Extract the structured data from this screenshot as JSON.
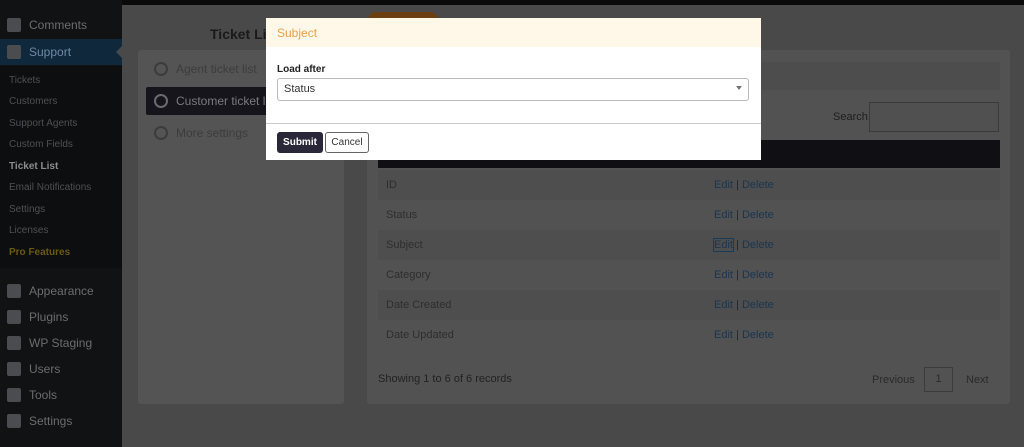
{
  "sidebar": {
    "items": [
      {
        "label": "Comments",
        "icon": "comment-icon"
      },
      {
        "label": "Support",
        "icon": "support-icon",
        "active": true
      },
      {
        "label": "Appearance",
        "icon": "brush-icon"
      },
      {
        "label": "Plugins",
        "icon": "plugin-icon"
      },
      {
        "label": "WP Staging",
        "icon": "sync-icon"
      },
      {
        "label": "Users",
        "icon": "user-icon"
      },
      {
        "label": "Tools",
        "icon": "wrench-icon"
      },
      {
        "label": "Settings",
        "icon": "settings-icon"
      }
    ],
    "submenu": [
      "Tickets",
      "Customers",
      "Support Agents",
      "Custom Fields",
      "Ticket List",
      "Email Notifications",
      "Settings",
      "Licenses",
      "Pro Features"
    ]
  },
  "left_panel": {
    "title": "Ticket List",
    "items": [
      "Agent ticket list",
      "Customer ticket list",
      "More settings"
    ]
  },
  "table": {
    "search_label": "Search:",
    "rows": [
      "ID",
      "Status",
      "Subject",
      "Category",
      "Date Created",
      "Date Updated"
    ],
    "edit": "Edit",
    "sep": " | ",
    "delete": "Delete",
    "records": "Showing 1 to 6 of 6 records",
    "previous": "Previous",
    "page": "1",
    "next": "Next"
  },
  "modal": {
    "title": "Subject",
    "field_label": "Load after",
    "select_value": "Status",
    "submit": "Submit",
    "cancel": "Cancel"
  },
  "colors": {
    "modal_title": "#e8a04a",
    "submit_bg": "#2a2838"
  }
}
